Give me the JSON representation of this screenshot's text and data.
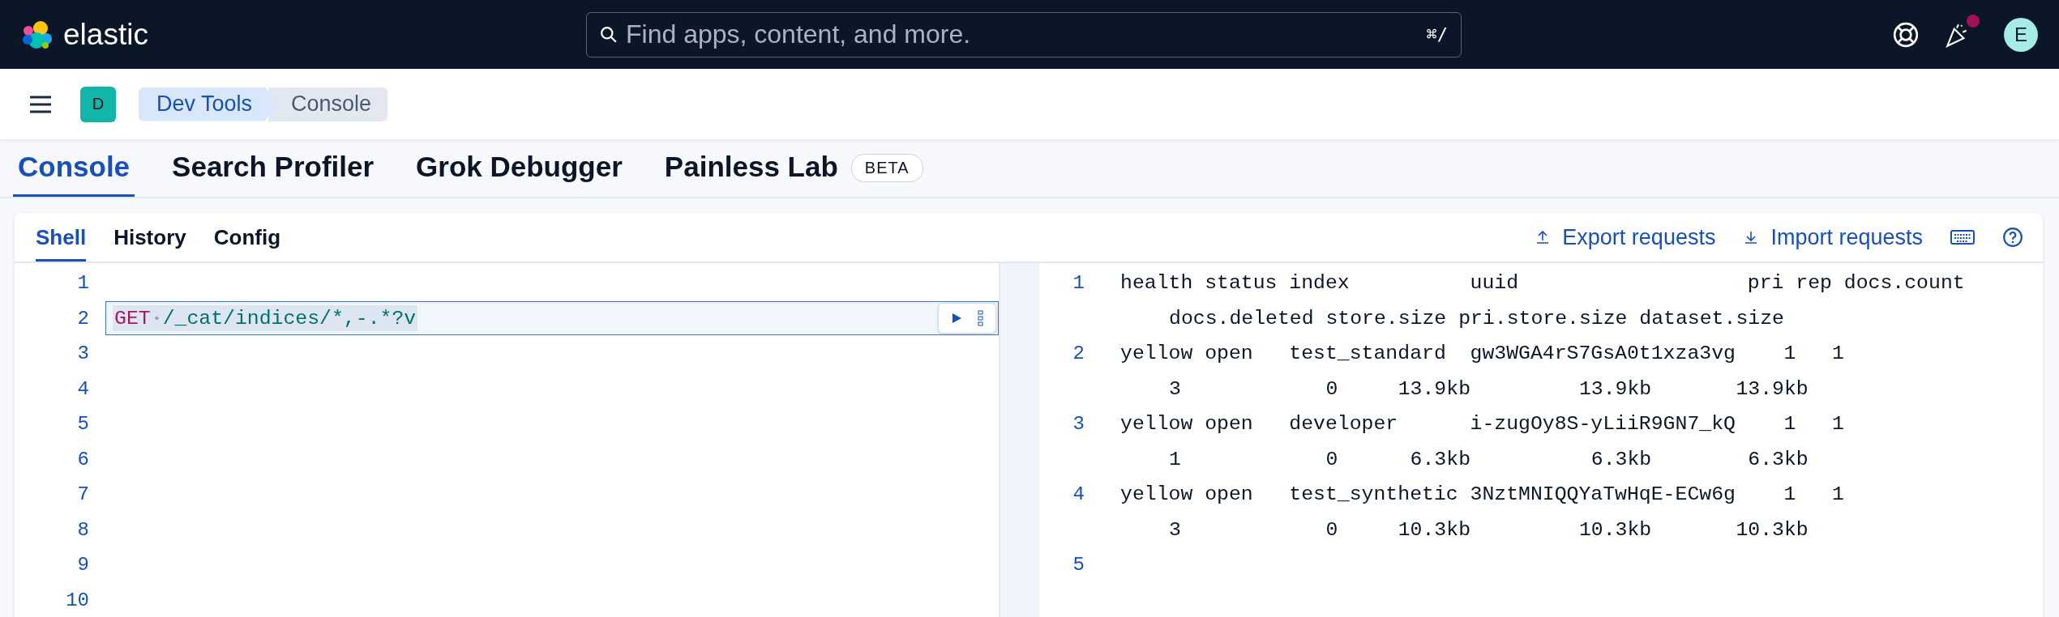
{
  "topbar": {
    "brand": "elastic",
    "search": {
      "placeholder": "Find apps, content, and more.",
      "shortcut": "⌘/"
    },
    "news_unread": true,
    "avatar": "E"
  },
  "header": {
    "space": "D",
    "breadcrumbs": [
      {
        "label": "Dev Tools",
        "current": false
      },
      {
        "label": "Console",
        "current": true
      }
    ]
  },
  "tabs": [
    {
      "label": "Console",
      "selected": true
    },
    {
      "label": "Search Profiler",
      "selected": false
    },
    {
      "label": "Grok Debugger",
      "selected": false
    },
    {
      "label": "Painless Lab",
      "selected": false,
      "badge": "BETA"
    }
  ],
  "console": {
    "tabs": [
      {
        "label": "Shell",
        "selected": true
      },
      {
        "label": "History",
        "selected": false
      },
      {
        "label": "Config",
        "selected": false
      }
    ],
    "actions": [
      {
        "label": "Export requests",
        "kind": "export"
      },
      {
        "label": "Import requests",
        "kind": "import"
      }
    ],
    "editor": {
      "lines": [
        {
          "number": "1"
        },
        {
          "number": "2",
          "method": "GET",
          "path": "/_cat/indices/*,-.*?v",
          "selected": true
        },
        {
          "number": "3"
        },
        {
          "number": "4"
        },
        {
          "number": "5"
        },
        {
          "number": "6"
        },
        {
          "number": "7"
        },
        {
          "number": "8"
        },
        {
          "number": "9"
        },
        {
          "number": "10"
        }
      ]
    },
    "output": {
      "lines": [
        {
          "number": "1",
          "text": "health status index          uuid                   pri rep docs.count",
          "wrap": "docs.deleted store.size pri.store.size dataset.size"
        },
        {
          "number": "2",
          "text": "yellow open   test_standard  gw3WGA4rS7GsA0t1xza3vg    1   1",
          "wrap": "3            0     13.9kb         13.9kb       13.9kb"
        },
        {
          "number": "3",
          "text": "yellow open   developer      i-zugOy8S-yLiiR9GN7_kQ    1   1",
          "wrap": "1            0      6.3kb          6.3kb        6.3kb"
        },
        {
          "number": "4",
          "text": "yellow open   test_synthetic 3NztMNIQQYaTwHqE-ECw6g    1   1",
          "wrap": "3            0     10.3kb         10.3kb       10.3kb"
        },
        {
          "number": "5"
        }
      ]
    }
  }
}
